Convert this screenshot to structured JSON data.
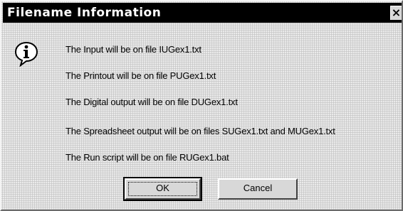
{
  "dialog": {
    "title": "Filename Information",
    "close_label": "×",
    "icon": "info-icon",
    "messages": [
      "The Input will be on file IUGex1.txt",
      "The Printout will be on file PUGex1.txt",
      "The Digital output will be on file DUGex1.txt",
      "The Spreadsheet output will be on files SUGex1.txt and MUGex1.txt",
      "The Run script will be on file RUGex1.bat"
    ],
    "buttons": {
      "ok_label": "OK",
      "cancel_label": "Cancel"
    }
  },
  "colors": {
    "titlebar": "#000000",
    "title_text": "#ffffff",
    "dialog_background": "#dcdcdc"
  }
}
